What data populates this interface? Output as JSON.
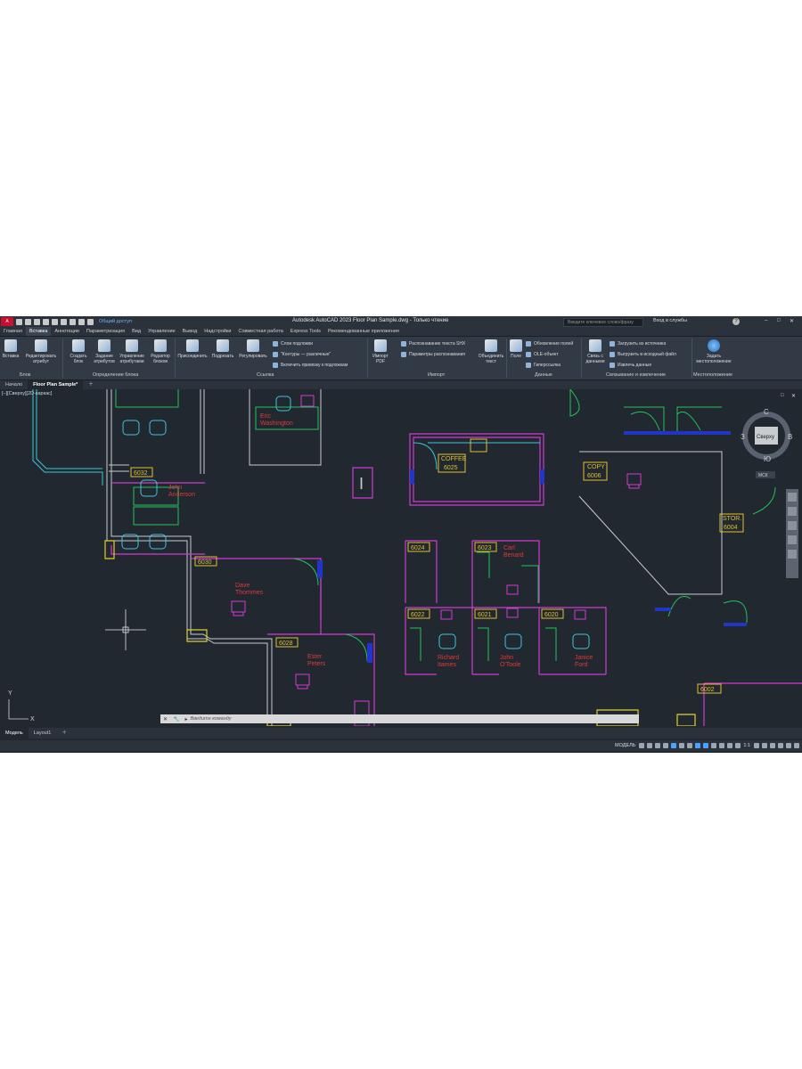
{
  "app": {
    "badge": "A CAD",
    "share_label": "Общий доступ",
    "window_title": "Autodesk AutoCAD 2023   Floor Plan Sample.dwg - Только чтение",
    "search_placeholder": "Введите ключевое слово/фразу",
    "login_label": "Вход в службы"
  },
  "menu": [
    "Главная",
    "Вставка",
    "Аннотации",
    "Параметризация",
    "Вид",
    "Управление",
    "Вывод",
    "Надстройки",
    "Совместная работа",
    "Express Tools",
    "Рекомендованные приложения"
  ],
  "menu_active_index": 1,
  "ribbon": {
    "block": {
      "insert": "Вставка",
      "edit_attr": "Редактировать атрибут",
      "label": "Блок"
    },
    "block_def": {
      "create": "Создать блок",
      "define_attr": "Задание атрибутов",
      "manage_attr": "Управление атрибутами",
      "block_editor": "Редактор блоков",
      "label": "Определение блока"
    },
    "reference": {
      "attach": "Присоединить",
      "clip": "Подрезать",
      "adjust": "Регулировать",
      "underlay_layers": "Слои подложки",
      "frames": "\"Контуры — различные\"",
      "snap_underlay": "Включить привязку к подложкам",
      "label": "Ссылка"
    },
    "import": {
      "pdf": "Импорт PDF",
      "shx": "Распознавание текста SHX",
      "recog_params": "Параметры распознавания",
      "combine_text": "Объединить текст",
      "label": "Импорт"
    },
    "data": {
      "field": "Поле",
      "update_fields": "Обновление полей",
      "ole": "OLE-объект",
      "hyperlink": "Гиперссылка",
      "label": "Данные"
    },
    "linking": {
      "link_data": "Связь с данными",
      "download_source": "Загрузить из источника",
      "upload_source": "Выгрузить в исходный файл",
      "extract_data": "Извлечь данные",
      "label": "Связывание и извлечение"
    },
    "location": {
      "set_location": "Задать местоположение",
      "label": "Местоположение"
    }
  },
  "file_tabs": [
    "Начало",
    "Floor Plan Sample*"
  ],
  "viewport_label": "[–][Сверху][2D-каркас]",
  "viewcube": {
    "top": "Сверху",
    "north": "С",
    "south": "Ю",
    "west": "З",
    "east": "В",
    "wcs": "МСК"
  },
  "rooms": [
    "6032",
    "6030",
    "6028",
    "6025",
    "6024",
    "6023",
    "6022",
    "6021",
    "6020",
    "6006",
    "6004",
    "6002"
  ],
  "room_tags": {
    "coffee": "COFFEE",
    "copy": "COPY",
    "stor": "STOR."
  },
  "people": {
    "eric": [
      "Eric",
      "Washington"
    ],
    "john": [
      "John",
      "Anderson"
    ],
    "dave": [
      "Dave",
      "Thommes"
    ],
    "ester": [
      "Ester",
      "Peters"
    ],
    "carl": [
      "Carl",
      "Benard"
    ],
    "richard": [
      "Richard",
      "Itames"
    ],
    "john2": [
      "John",
      "O'Toole"
    ],
    "janice": [
      "Janice",
      "Ford"
    ]
  },
  "command_placeholder": "Введите команду",
  "layout_tabs": [
    "Модель",
    "Layout1"
  ],
  "status": {
    "model": "МОДЕЛЬ",
    "scale": "1:1"
  }
}
